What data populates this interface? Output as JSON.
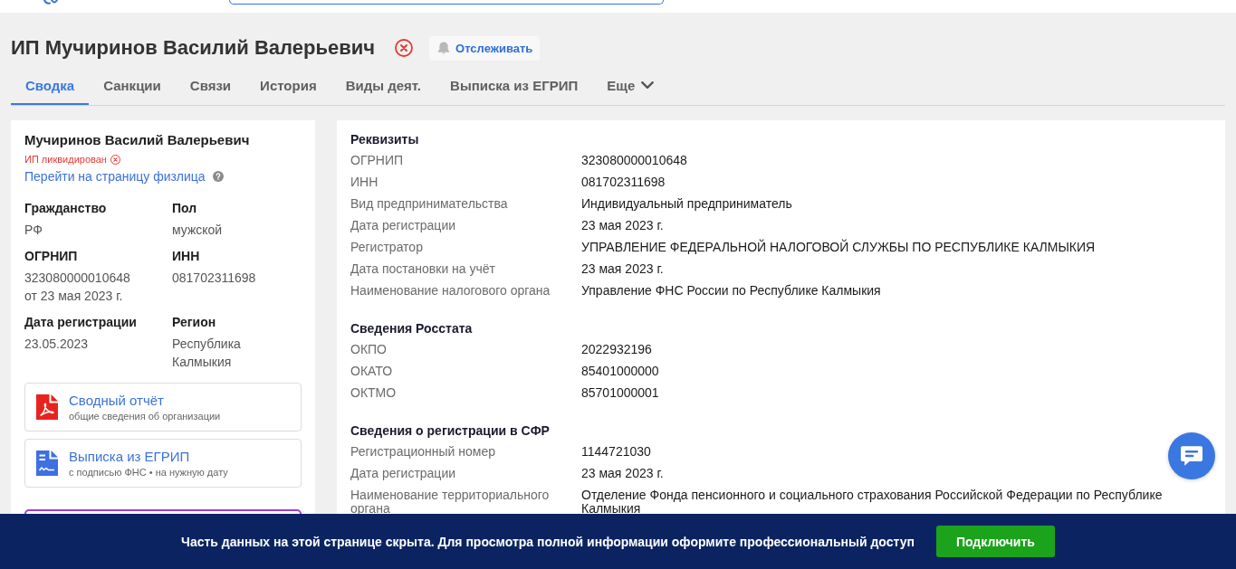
{
  "header": {
    "title": "ИП Мучиринов Василий Валерьевич",
    "track_button": "Отслеживать"
  },
  "tabs": [
    {
      "label": "Сводка",
      "selected": true,
      "kind": "tab"
    },
    {
      "label": "Санкции",
      "selected": false,
      "kind": "tab"
    },
    {
      "label": "Связи",
      "selected": false,
      "kind": "tab"
    },
    {
      "label": "История",
      "selected": false,
      "kind": "tab"
    },
    {
      "label": "Виды деят.",
      "selected": false,
      "kind": "tab"
    },
    {
      "label": "Выписка из ЕГРИП",
      "selected": false,
      "kind": "tab"
    },
    {
      "label": "Еще",
      "selected": false,
      "kind": "dropdown"
    }
  ],
  "summary_card": {
    "name": "Мучиринов Василий Валерьевич",
    "status": "ИП ликвидирован",
    "person_link": "Перейти на страницу физлица",
    "fields": [
      {
        "label": "Гражданство",
        "value": "РФ"
      },
      {
        "label": "Пол",
        "value": "мужской"
      },
      {
        "label": "ОГРНИП",
        "value": "323080000010648",
        "note": "от 23 мая 2023 г."
      },
      {
        "label": "ИНН",
        "value": "081702311698"
      },
      {
        "label": "Дата регистрации",
        "value": "23.05.2023"
      },
      {
        "label": "Регион",
        "value": "Республика Калмыкия"
      }
    ],
    "documents": [
      {
        "kind": "pdf",
        "title": "Сводный отчёт",
        "subtitle": "общие сведения об организации"
      },
      {
        "kind": "extract",
        "title": "Выписка из ЕГРИП",
        "subtitle": "с подписью ФНС • на нужную дату"
      }
    ]
  },
  "details_card": {
    "sections": [
      {
        "title": "Реквизиты",
        "rows": [
          {
            "label": "ОГРНИП",
            "value": "323080000010648"
          },
          {
            "label": "ИНН",
            "value": "081702311698"
          },
          {
            "label": "Вид предпринимательства",
            "value": "Индивидуальный предприниматель"
          },
          {
            "label": "Дата регистрации",
            "value": "23 мая 2023 г."
          },
          {
            "label": "Регистратор",
            "value": "УПРАВЛЕНИЕ ФЕДЕРАЛЬНОЙ НАЛОГОВОЙ СЛУЖБЫ ПО РЕСПУБЛИКЕ КАЛМЫКИЯ"
          },
          {
            "label": "Дата постановки на учёт",
            "value": "23 мая 2023 г."
          },
          {
            "label": "Наименование налогового органа",
            "value": "Управление ФНС России по Республике Калмыкия"
          }
        ]
      },
      {
        "title": "Сведения Росстата",
        "rows": [
          {
            "label": "ОКПО",
            "value": "2022932196"
          },
          {
            "label": "ОКАТО",
            "value": "85401000000"
          },
          {
            "label": "ОКТМО",
            "value": "85701000001"
          }
        ]
      },
      {
        "title": "Сведения о регистрации в СФР",
        "rows": [
          {
            "label": "Регистрационный номер",
            "value": "1144721030"
          },
          {
            "label": "Дата регистрации",
            "value": "23 мая 2023 г."
          },
          {
            "label": "Наименование территориального органа",
            "value": "Отделение Фонда пенсионного и социального страхования Российской Федерации по Республике Калмыкия"
          }
        ]
      }
    ]
  },
  "banner": {
    "message": "Часть данных на этой странице скрыта. Для просмотра полной информации оформите профессиональный доступ",
    "button": "Подключить"
  }
}
